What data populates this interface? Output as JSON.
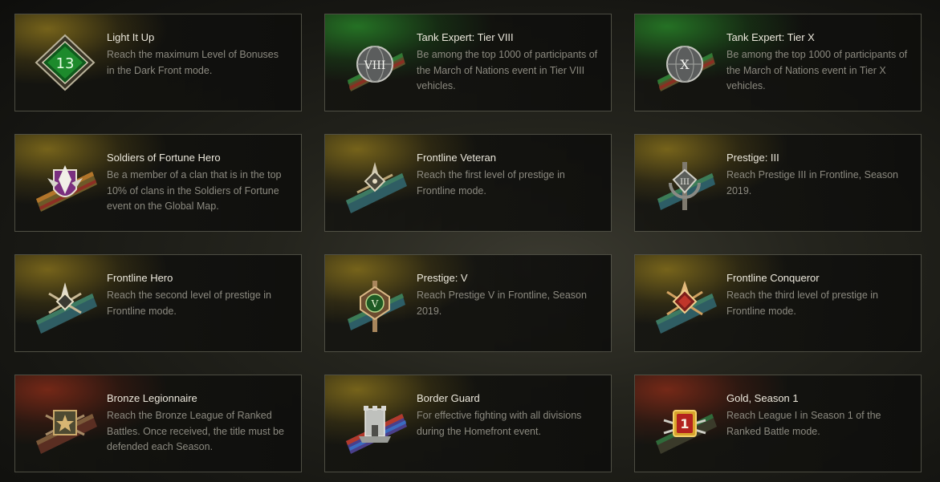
{
  "achievements": [
    {
      "title": "Light It Up",
      "description": "Reach the maximum Level of Bonuses in the Dark Front mode.",
      "glow": "gold",
      "icon": "diamond-13-badge-icon",
      "badge_text": "13"
    },
    {
      "title": "Tank Expert: Tier VIII",
      "description": "Be among the top 1000 of participants of the March of Nations event in Tier VIII vehicles.",
      "glow": "green",
      "icon": "globe-tier-viii-medal-icon",
      "badge_text": "VIII"
    },
    {
      "title": "Tank Expert: Tier X",
      "description": "Be among the top 1000 of participants of the March of Nations event in Tier X vehicles.",
      "glow": "green",
      "icon": "globe-tier-x-medal-icon",
      "badge_text": "X"
    },
    {
      "title": "Soldiers of Fortune Hero",
      "description": "Be a member of a clan that is in the top 10% of clans in the Soldiers of Fortune event on the Global Map.",
      "glow": "gold",
      "icon": "eagle-shield-medal-icon",
      "badge_text": ""
    },
    {
      "title": "Frontline Veteran",
      "description": "Reach the first level of prestige in Frontline mode.",
      "glow": "gold",
      "icon": "frontline-star-medal-icon",
      "badge_text": ""
    },
    {
      "title": "Prestige: III",
      "description": "Reach Prestige III in Frontline, Season 2019.",
      "glow": "gold",
      "icon": "prestige-iii-medal-icon",
      "badge_text": "III"
    },
    {
      "title": "Frontline Hero",
      "description": "Reach the second level of prestige in Frontline mode.",
      "glow": "gold",
      "icon": "frontline-hero-medal-icon",
      "badge_text": ""
    },
    {
      "title": "Prestige: V",
      "description": "Reach Prestige V in Frontline, Season 2019.",
      "glow": "gold",
      "icon": "prestige-v-medal-icon",
      "badge_text": "V"
    },
    {
      "title": "Frontline Conqueror",
      "description": "Reach the third level of prestige in Frontline mode.",
      "glow": "gold",
      "icon": "frontline-conqueror-medal-icon",
      "badge_text": ""
    },
    {
      "title": "Bronze Legionnaire",
      "description": "Reach the Bronze League of Ranked Battles. Once received, the title must be defended each Season.",
      "glow": "red",
      "icon": "bronze-star-medal-icon",
      "badge_text": ""
    },
    {
      "title": "Border Guard",
      "description": "For effective fighting with all divisions during the Homefront event.",
      "glow": "gold",
      "icon": "fortress-tower-medal-icon",
      "badge_text": ""
    },
    {
      "title": "Gold, Season 1",
      "description": "Reach League I in Season 1 of the Ranked Battle mode.",
      "glow": "red",
      "icon": "gold-league-1-medal-icon",
      "badge_text": "1"
    }
  ],
  "colors": {
    "title": "#ece8dc",
    "description": "#8c8a80",
    "gold_glow": "#967d1e",
    "green_glow": "#288228",
    "red_glow": "#8c2d19"
  }
}
